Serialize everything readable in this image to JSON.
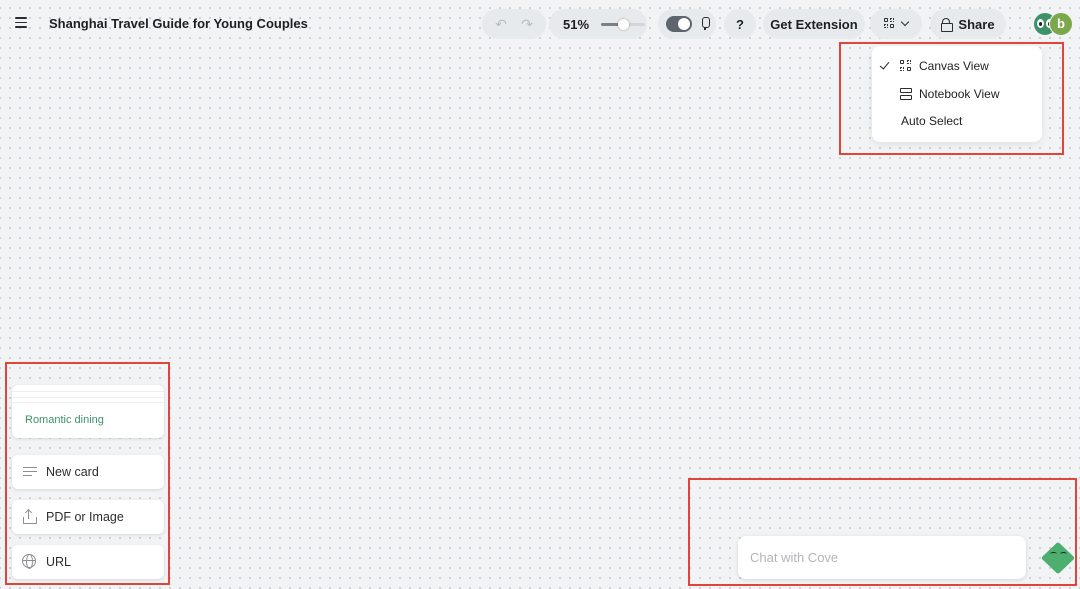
{
  "document": {
    "title": "Shanghai Travel Guide for Young Couples"
  },
  "toolbar": {
    "zoom": {
      "value_label": "51%",
      "level": 0.51
    },
    "help_label": "?",
    "extension_label": "Get Extension",
    "share_label": "Share"
  },
  "collaborators": [
    {
      "type": "eyes-avatar",
      "color": "#3d9268"
    },
    {
      "type": "letter-avatar",
      "letter": "b",
      "color": "#7aa84a"
    }
  ],
  "view_menu": {
    "items": [
      {
        "label": "Canvas View",
        "checked": true,
        "icon": "canvas-view-icon"
      },
      {
        "label": "Notebook View",
        "checked": false,
        "icon": "notebook-view-icon"
      },
      {
        "label": "Auto Select",
        "checked": false,
        "icon": ""
      }
    ]
  },
  "add_panel": {
    "recent_label": "Romantic dining",
    "options": [
      {
        "label": "New card",
        "icon": "text-lines-icon"
      },
      {
        "label": "PDF or Image",
        "icon": "upload-icon"
      },
      {
        "label": "URL",
        "icon": "globe-icon"
      }
    ]
  },
  "chat": {
    "placeholder": "Chat with Cove",
    "value": ""
  },
  "colors": {
    "accent": "#3d9268",
    "highlight": "#e0443a",
    "canvas_bg": "#f1f3f5",
    "cove": "#4caf6f"
  }
}
